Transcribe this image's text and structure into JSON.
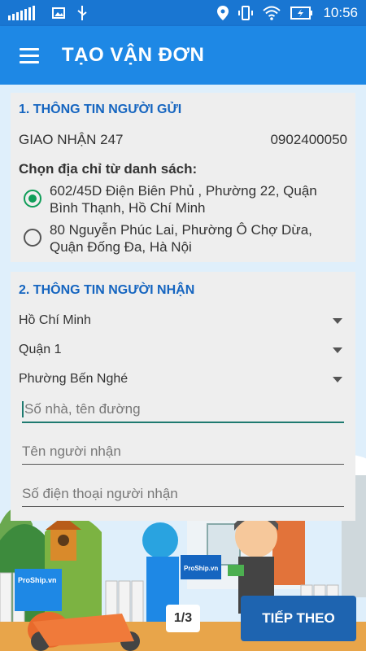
{
  "status_bar": {
    "time": "10:56"
  },
  "appbar": {
    "title": "TẠO VẬN ĐƠN"
  },
  "sender": {
    "heading": "1. THÔNG TIN NGƯỜI GỬI",
    "name": "GIAO NHẬN 247",
    "phone": "0902400050",
    "choose_label": "Chọn địa chỉ từ danh sách:",
    "addresses": [
      {
        "line1": "602/45D Điện Biên Phủ , Phường 22, Quận",
        "line2": "Bình Thạnh, Hồ Chí Minh",
        "selected": true
      },
      {
        "line1": "80 Nguyễn Phúc Lai, Phường Ô Chợ Dừa,",
        "line2": "Quận Đống Đa, Hà Nội",
        "selected": false
      }
    ]
  },
  "receiver": {
    "heading": "2. THÔNG TIN NGƯỜI NHẬN",
    "city": "Hồ Chí Minh",
    "district": "Quận 1",
    "ward": "Phường Bến Nghé",
    "street_placeholder": "Số nhà, tên đường",
    "name_placeholder": "Tên người nhận",
    "phone_placeholder": "Số điện thoại người nhận"
  },
  "illustration": {
    "brand": "ProShip.vn"
  },
  "footer": {
    "page_indicator": "1/3",
    "next_label": "TIẾP THEO"
  },
  "colors": {
    "primary": "#1e88e5",
    "statusbar": "#1976d2",
    "section_heading": "#1565c0",
    "radio_selected": "#0f9d58",
    "next_button": "#1e64b0"
  }
}
